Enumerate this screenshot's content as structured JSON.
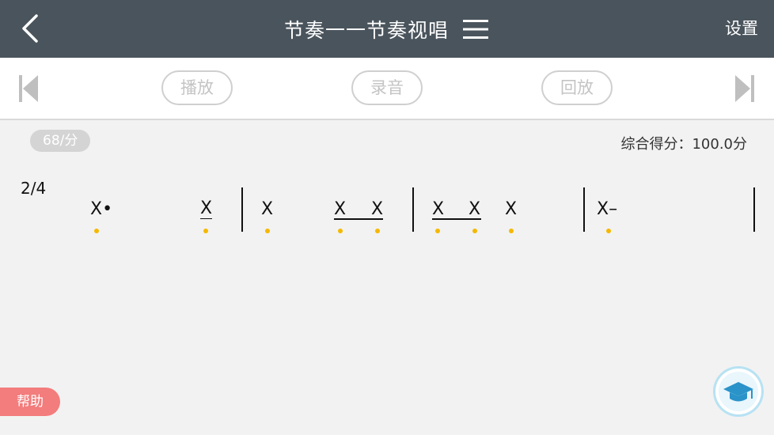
{
  "header": {
    "title": "节奏一一节奏视唱",
    "settings_label": "设置"
  },
  "toolbar": {
    "play_label": "播放",
    "record_label": "录音",
    "playback_label": "回放"
  },
  "info": {
    "tempo": "68/分",
    "score": "综合得分：100.0分"
  },
  "notation": {
    "time_signature": "2/4",
    "notes": [
      "X•",
      "X",
      "X",
      "X",
      "X",
      "X",
      "X",
      "X",
      "X–"
    ]
  },
  "help_label": "帮助",
  "colors": {
    "header_bg": "#4a545c",
    "dot": "#f5b800",
    "help_bg": "#f37c7c",
    "fab_ring": "#b7e2f3"
  },
  "icons": [
    "back-arrow-icon",
    "menu-icon",
    "skip-previous-icon",
    "skip-next-icon",
    "graduation-cap-icon"
  ]
}
